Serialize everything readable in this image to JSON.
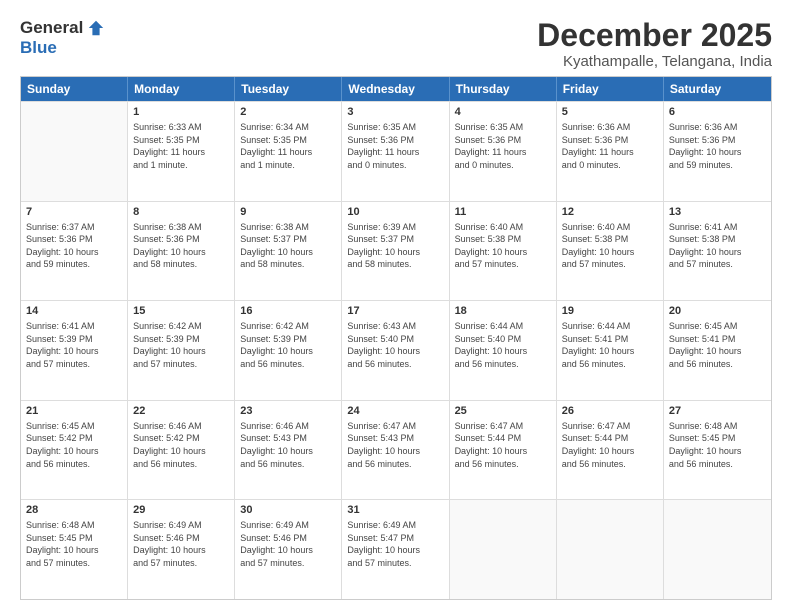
{
  "logo": {
    "general": "General",
    "blue": "Blue"
  },
  "title": "December 2025",
  "subtitle": "Kyathampalle, Telangana, India",
  "header": {
    "days": [
      "Sunday",
      "Monday",
      "Tuesday",
      "Wednesday",
      "Thursday",
      "Friday",
      "Saturday"
    ]
  },
  "weeks": [
    [
      {
        "day": "",
        "info": ""
      },
      {
        "day": "1",
        "info": "Sunrise: 6:33 AM\nSunset: 5:35 PM\nDaylight: 11 hours\nand 1 minute."
      },
      {
        "day": "2",
        "info": "Sunrise: 6:34 AM\nSunset: 5:35 PM\nDaylight: 11 hours\nand 1 minute."
      },
      {
        "day": "3",
        "info": "Sunrise: 6:35 AM\nSunset: 5:36 PM\nDaylight: 11 hours\nand 0 minutes."
      },
      {
        "day": "4",
        "info": "Sunrise: 6:35 AM\nSunset: 5:36 PM\nDaylight: 11 hours\nand 0 minutes."
      },
      {
        "day": "5",
        "info": "Sunrise: 6:36 AM\nSunset: 5:36 PM\nDaylight: 11 hours\nand 0 minutes."
      },
      {
        "day": "6",
        "info": "Sunrise: 6:36 AM\nSunset: 5:36 PM\nDaylight: 10 hours\nand 59 minutes."
      }
    ],
    [
      {
        "day": "7",
        "info": "Sunrise: 6:37 AM\nSunset: 5:36 PM\nDaylight: 10 hours\nand 59 minutes."
      },
      {
        "day": "8",
        "info": "Sunrise: 6:38 AM\nSunset: 5:36 PM\nDaylight: 10 hours\nand 58 minutes."
      },
      {
        "day": "9",
        "info": "Sunrise: 6:38 AM\nSunset: 5:37 PM\nDaylight: 10 hours\nand 58 minutes."
      },
      {
        "day": "10",
        "info": "Sunrise: 6:39 AM\nSunset: 5:37 PM\nDaylight: 10 hours\nand 58 minutes."
      },
      {
        "day": "11",
        "info": "Sunrise: 6:40 AM\nSunset: 5:38 PM\nDaylight: 10 hours\nand 57 minutes."
      },
      {
        "day": "12",
        "info": "Sunrise: 6:40 AM\nSunset: 5:38 PM\nDaylight: 10 hours\nand 57 minutes."
      },
      {
        "day": "13",
        "info": "Sunrise: 6:41 AM\nSunset: 5:38 PM\nDaylight: 10 hours\nand 57 minutes."
      }
    ],
    [
      {
        "day": "14",
        "info": "Sunrise: 6:41 AM\nSunset: 5:39 PM\nDaylight: 10 hours\nand 57 minutes."
      },
      {
        "day": "15",
        "info": "Sunrise: 6:42 AM\nSunset: 5:39 PM\nDaylight: 10 hours\nand 57 minutes."
      },
      {
        "day": "16",
        "info": "Sunrise: 6:42 AM\nSunset: 5:39 PM\nDaylight: 10 hours\nand 56 minutes."
      },
      {
        "day": "17",
        "info": "Sunrise: 6:43 AM\nSunset: 5:40 PM\nDaylight: 10 hours\nand 56 minutes."
      },
      {
        "day": "18",
        "info": "Sunrise: 6:44 AM\nSunset: 5:40 PM\nDaylight: 10 hours\nand 56 minutes."
      },
      {
        "day": "19",
        "info": "Sunrise: 6:44 AM\nSunset: 5:41 PM\nDaylight: 10 hours\nand 56 minutes."
      },
      {
        "day": "20",
        "info": "Sunrise: 6:45 AM\nSunset: 5:41 PM\nDaylight: 10 hours\nand 56 minutes."
      }
    ],
    [
      {
        "day": "21",
        "info": "Sunrise: 6:45 AM\nSunset: 5:42 PM\nDaylight: 10 hours\nand 56 minutes."
      },
      {
        "day": "22",
        "info": "Sunrise: 6:46 AM\nSunset: 5:42 PM\nDaylight: 10 hours\nand 56 minutes."
      },
      {
        "day": "23",
        "info": "Sunrise: 6:46 AM\nSunset: 5:43 PM\nDaylight: 10 hours\nand 56 minutes."
      },
      {
        "day": "24",
        "info": "Sunrise: 6:47 AM\nSunset: 5:43 PM\nDaylight: 10 hours\nand 56 minutes."
      },
      {
        "day": "25",
        "info": "Sunrise: 6:47 AM\nSunset: 5:44 PM\nDaylight: 10 hours\nand 56 minutes."
      },
      {
        "day": "26",
        "info": "Sunrise: 6:47 AM\nSunset: 5:44 PM\nDaylight: 10 hours\nand 56 minutes."
      },
      {
        "day": "27",
        "info": "Sunrise: 6:48 AM\nSunset: 5:45 PM\nDaylight: 10 hours\nand 56 minutes."
      }
    ],
    [
      {
        "day": "28",
        "info": "Sunrise: 6:48 AM\nSunset: 5:45 PM\nDaylight: 10 hours\nand 57 minutes."
      },
      {
        "day": "29",
        "info": "Sunrise: 6:49 AM\nSunset: 5:46 PM\nDaylight: 10 hours\nand 57 minutes."
      },
      {
        "day": "30",
        "info": "Sunrise: 6:49 AM\nSunset: 5:46 PM\nDaylight: 10 hours\nand 57 minutes."
      },
      {
        "day": "31",
        "info": "Sunrise: 6:49 AM\nSunset: 5:47 PM\nDaylight: 10 hours\nand 57 minutes."
      },
      {
        "day": "",
        "info": ""
      },
      {
        "day": "",
        "info": ""
      },
      {
        "day": "",
        "info": ""
      }
    ]
  ]
}
